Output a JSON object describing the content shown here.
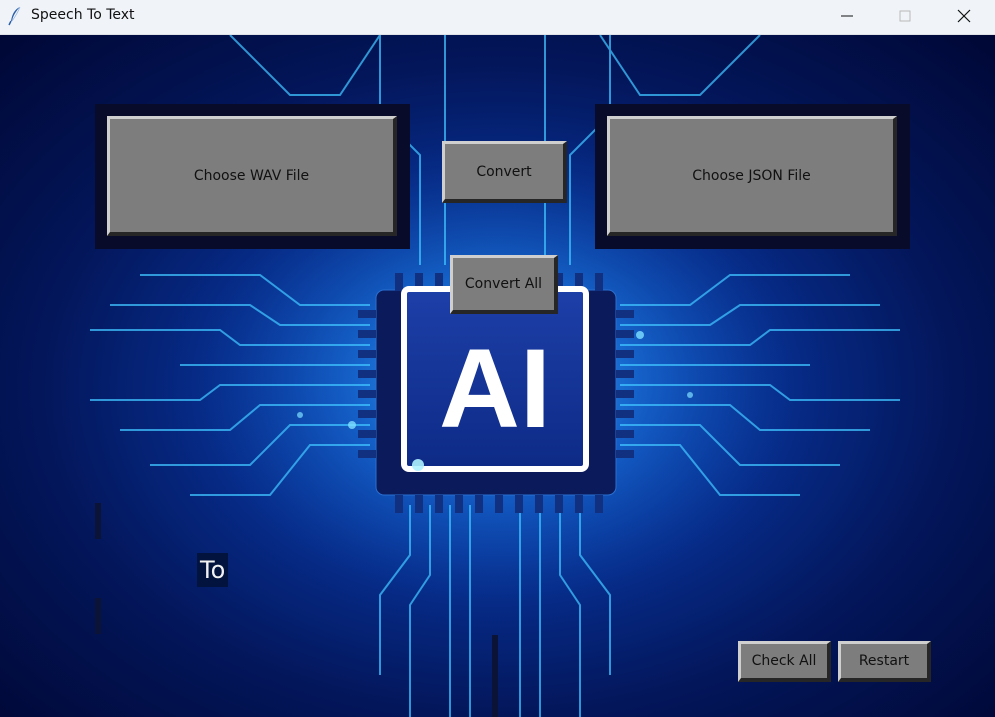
{
  "window": {
    "title": "Speech To Text",
    "icon": "feather-icon"
  },
  "buttons": {
    "choose_wav": "Choose WAV File",
    "convert": "Convert",
    "choose_json": "Choose JSON File",
    "convert_all": "Convert All",
    "check_all": "Check All",
    "restart": "Restart"
  },
  "labels": {
    "to": "To"
  },
  "background": {
    "chip_text": "AI",
    "theme": "circuit-board-ai-chip"
  }
}
